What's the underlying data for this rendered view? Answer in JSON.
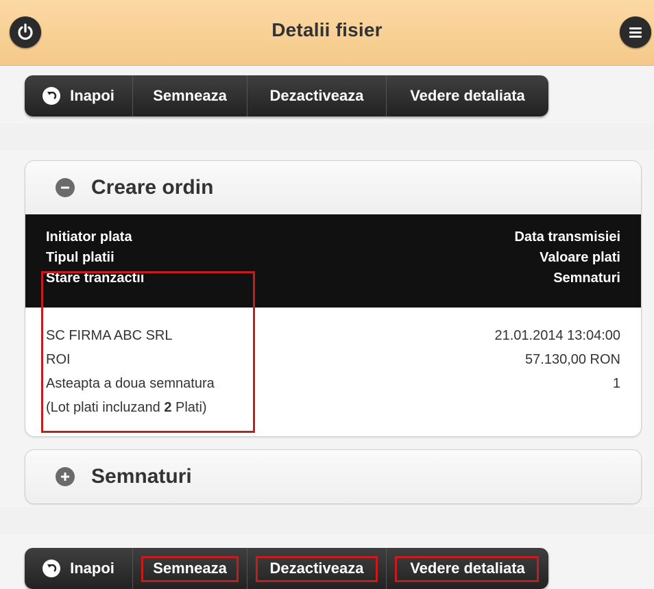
{
  "header": {
    "title": "Detalii fisier",
    "left_icon": "power-icon",
    "right_icon": "menu-icon"
  },
  "toolbar_top": {
    "back_label": "Inapoi",
    "sign_label": "Semneaza",
    "deactivate_label": "Dezactiveaza",
    "detail_label": "Vedere detaliata"
  },
  "section_order": {
    "title": "Creare ordin",
    "icon": "minus-circle-icon",
    "headers": {
      "initiator": "Initiator plata",
      "type": "Tipul platii",
      "status": "Stare tranzactii",
      "date": "Data transmisiei",
      "value": "Valoare plati",
      "signatures": "Semnaturi"
    },
    "values": {
      "initiator": "SC FIRMA ABC SRL",
      "type": "ROI",
      "status": "Asteapta a doua semnatura",
      "lot_prefix": "(Lot plati incluzand ",
      "lot_count": "2",
      "lot_suffix": " Plati)",
      "date": "21.01.2014 13:04:00",
      "value": "57.130,00 RON",
      "signatures": "1"
    }
  },
  "section_signatures": {
    "title": "Semnaturi",
    "icon": "plus-circle-icon"
  },
  "toolbar_bottom": {
    "back_label": "Inapoi",
    "sign_label": "Semneaza",
    "deactivate_label": "Dezactiveaza",
    "detail_label": "Vedere detaliata"
  },
  "colors": {
    "header_bg": "#f5c98a",
    "highlight": "#c91b1b",
    "dark_row": "#111111"
  }
}
